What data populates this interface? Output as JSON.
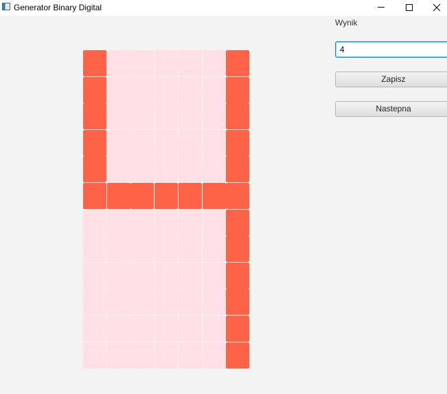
{
  "window": {
    "title": "Generator Binary Digital",
    "icon": "app-window-icon",
    "controls": [
      "minimize-icon",
      "maximize-icon",
      "close-icon"
    ]
  },
  "grid": {
    "rows": 12,
    "cols": 7,
    "on_color": "#ff6347",
    "off_color": "#ffe0e6",
    "cells": [
      [
        1,
        0,
        0,
        0,
        0,
        0,
        1
      ],
      [
        1,
        0,
        0,
        0,
        0,
        0,
        1
      ],
      [
        1,
        0,
        0,
        0,
        0,
        0,
        1
      ],
      [
        1,
        0,
        0,
        0,
        0,
        0,
        1
      ],
      [
        1,
        0,
        0,
        0,
        0,
        0,
        1
      ],
      [
        1,
        1,
        1,
        1,
        1,
        1,
        1
      ],
      [
        0,
        0,
        0,
        0,
        0,
        0,
        1
      ],
      [
        0,
        0,
        0,
        0,
        0,
        0,
        1
      ],
      [
        0,
        0,
        0,
        0,
        0,
        0,
        1
      ],
      [
        0,
        0,
        0,
        0,
        0,
        0,
        1
      ],
      [
        0,
        0,
        0,
        0,
        0,
        0,
        1
      ],
      [
        0,
        0,
        0,
        0,
        0,
        0,
        1
      ]
    ]
  },
  "side": {
    "result_label": "Wynik",
    "result_value": "4",
    "save_label": "Zapisz",
    "next_label": "Nastepna"
  }
}
